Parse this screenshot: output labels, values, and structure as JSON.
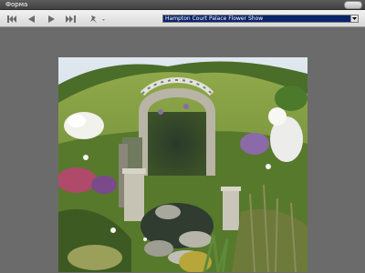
{
  "window": {
    "title": "Форма"
  },
  "toolbar": {
    "first_icon": "first-frame-icon",
    "prev_icon": "previous-icon",
    "next_icon": "next-icon",
    "last_icon": "last-frame-icon",
    "pin_icon": "pin-icon",
    "selected_album": "Hampton Court Palace Flower Show"
  },
  "photo": {
    "subject": "garden-arch-photo",
    "colors": {
      "sky": "#d9e4ec",
      "hill": "#7d9a3e",
      "stone": "#b8b4a6",
      "flowers_white": "#f4f4f0",
      "flowers_purple": "#8a6aa8",
      "foliage": "#3f5f22"
    }
  }
}
